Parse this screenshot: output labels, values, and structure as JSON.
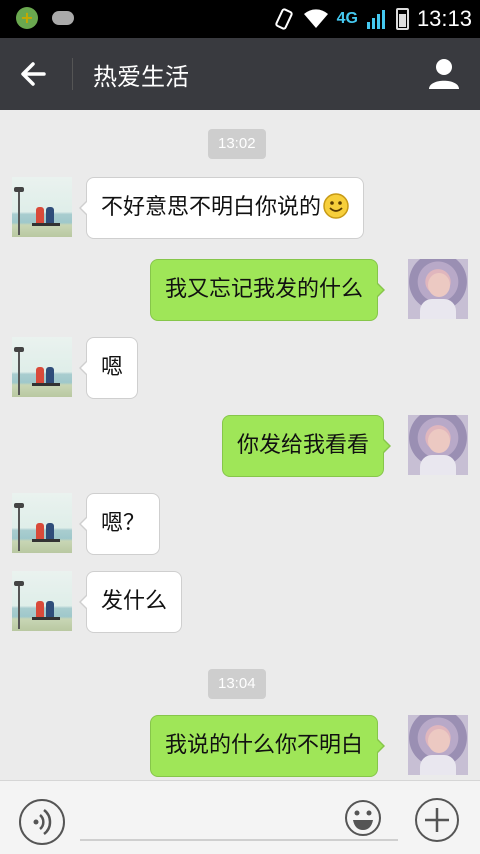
{
  "status_bar": {
    "network": "4G",
    "time": "13:13"
  },
  "header": {
    "title": "热爱生活",
    "back_icon": "arrow-left-icon",
    "profile_icon": "person-icon"
  },
  "timestamps": [
    "13:02",
    "13:04"
  ],
  "messages": [
    {
      "side": "left",
      "text": "不好意思不明白你说的",
      "emoji": "smile-emoji"
    },
    {
      "side": "right",
      "text": "我又忘记我发的什么"
    },
    {
      "side": "left",
      "text": "嗯"
    },
    {
      "side": "right",
      "text": "你发给我看看"
    },
    {
      "side": "left",
      "text": "嗯？"
    },
    {
      "side": "left",
      "text": "发什么"
    },
    {
      "side": "right",
      "text": "我说的什么你不明白"
    }
  ],
  "input_bar": {
    "value": "",
    "voice_icon": "voice-icon",
    "emoji_icon": "emoji-icon",
    "plus_icon": "plus-icon"
  }
}
